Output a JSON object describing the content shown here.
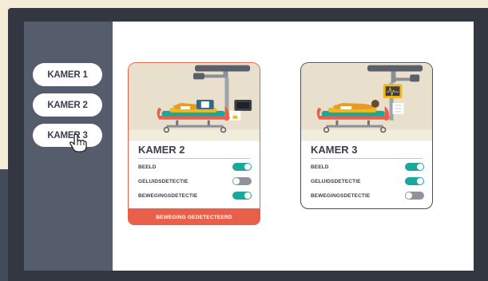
{
  "sidebar": {
    "rooms": [
      {
        "label": "KAMER 1"
      },
      {
        "label": "KAMER 2"
      },
      {
        "label": "KAMER 3"
      }
    ]
  },
  "cards": [
    {
      "title": "KAMER 2",
      "rows": [
        {
          "label": "BEELD",
          "state": "on"
        },
        {
          "label": "GELUIDSDETECTIE",
          "state": "off"
        },
        {
          "label": "BEWEGINGSDETECTIE",
          "state": "on"
        }
      ],
      "alert": "BEWEGING GEDETECTEERD"
    },
    {
      "title": "KAMER 3",
      "rows": [
        {
          "label": "BEELD",
          "state": "on"
        },
        {
          "label": "GELUIDSDETECTIE",
          "state": "on"
        },
        {
          "label": "BEWEGINGSDETECTIE",
          "state": "off"
        }
      ]
    }
  ],
  "colors": {
    "toggle_on": "#1aa79d",
    "toggle_off": "#8f949c",
    "alert": "#e8604a",
    "sidebar": "#555d6c",
    "frame": "#323741"
  }
}
